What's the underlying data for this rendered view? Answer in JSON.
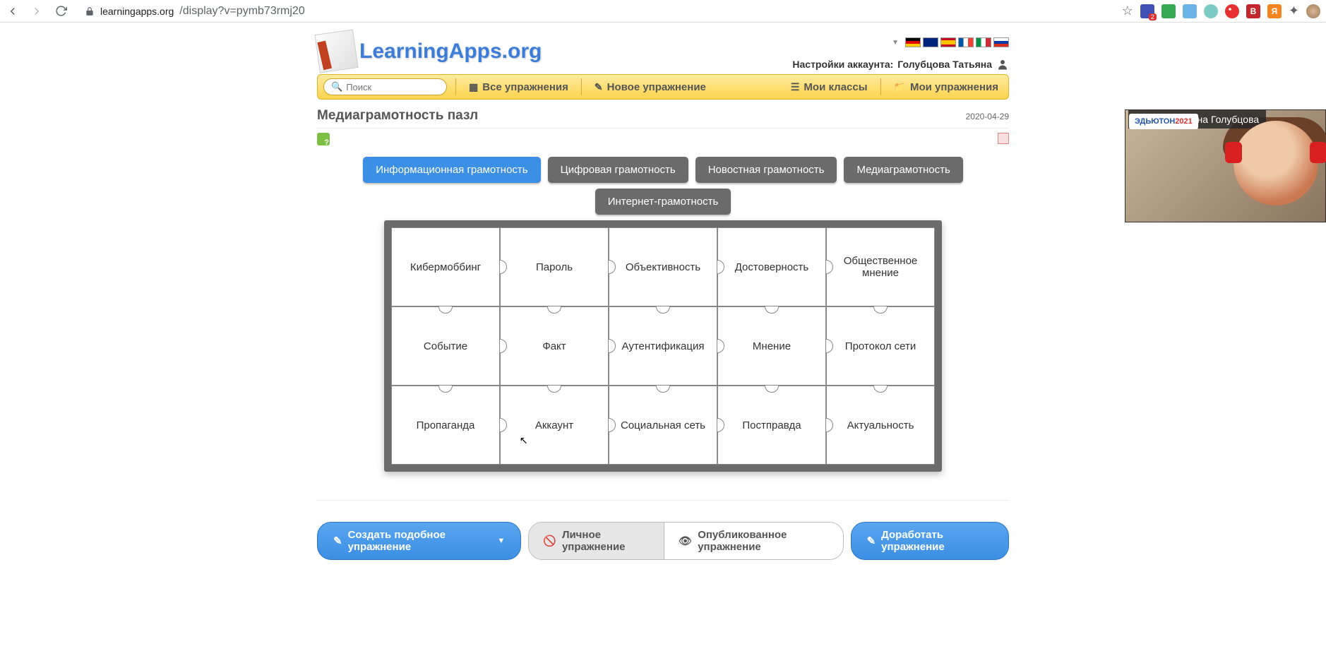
{
  "browser": {
    "url_host": "learningapps.org",
    "url_path": "/display?v=pymb73rmj20"
  },
  "header": {
    "logo": "LearningApps.org",
    "account_prefix": "Настройки аккаунта:",
    "account_name": "Голубцова Татьяна"
  },
  "navbar": {
    "search_placeholder": "Поиск",
    "all_exercises": "Все упражнения",
    "new_exercise": "Новое упражнение",
    "my_classes": "Мои классы",
    "my_exercises": "Мои упражнения"
  },
  "page_title": "Медиаграмотность пазл",
  "page_date": "2020-04-29",
  "categories": {
    "row1": [
      "Информационная грамотность",
      "Цифровая грамотность",
      "Новостная грамотность",
      "Медиаграмотность"
    ],
    "row2": [
      "Интернет-грамотность"
    ],
    "active_index": 0
  },
  "puzzle": [
    [
      "Кибермоббинг",
      "Пароль",
      "Объективность",
      "Достоверность",
      "Общественное мнение"
    ],
    [
      "Событие",
      "Факт",
      "Аутентификация",
      "Мнение",
      "Протокол сети"
    ],
    [
      "Пропаганда",
      "Аккаунт",
      "Социальная сеть",
      "Постправда",
      "Актуальность"
    ]
  ],
  "actions": {
    "create_similar": "Создать подобное упражнение",
    "private": "Личное упражнение",
    "published": "Опубликованное упражнение",
    "refine": "Доработать упражнение"
  },
  "video": {
    "badge_text": "ЭДЬЮТОН",
    "badge_year": "2021",
    "caption": "ментор Татьяна Голубцова"
  },
  "flags": [
    "#000",
    "#00247d",
    "#c60b1e",
    "#0055a4",
    "#009246",
    "#d52b1e"
  ]
}
